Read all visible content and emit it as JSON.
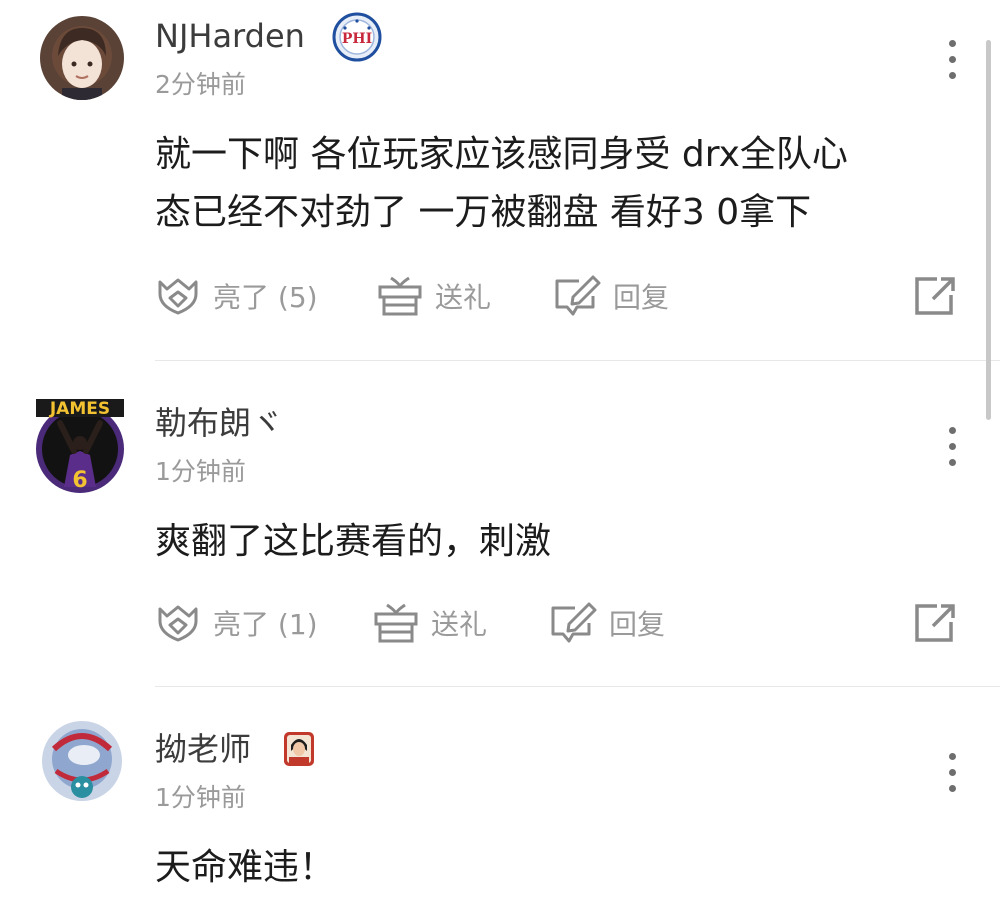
{
  "comments": [
    {
      "username": "NJHarden",
      "badge_icon": "76ers-logo-badge",
      "badge_text": "PHI",
      "time": "2分钟前",
      "text_lines": [
        "就一下啊 各位玩家应该感同身受 drx全队心",
        "态已经不对劲了 一万被翻盘 看好3 0拿下"
      ],
      "like_label": "亮了 (5)",
      "gift_label": "送礼",
      "reply_label": "回复"
    },
    {
      "username": "勒布朗ヾ",
      "avatar_text": "JAMES",
      "avatar_number": "6",
      "time": "1分钟前",
      "text_lines": [
        "爽翻了这比赛看的，刺激"
      ],
      "like_label": "亮了 (1)",
      "gift_label": "送礼",
      "reply_label": "回复"
    },
    {
      "username": "拗老师",
      "badge_icon": "portrait-badge",
      "time": "1分钟前",
      "text_lines": [
        "天命难违！"
      ]
    }
  ],
  "colors": {
    "text_primary": "#1c1c1c",
    "text_secondary": "#9a9a9a",
    "icon_gray": "#8a8a8a",
    "divider": "#e8e8e8"
  }
}
